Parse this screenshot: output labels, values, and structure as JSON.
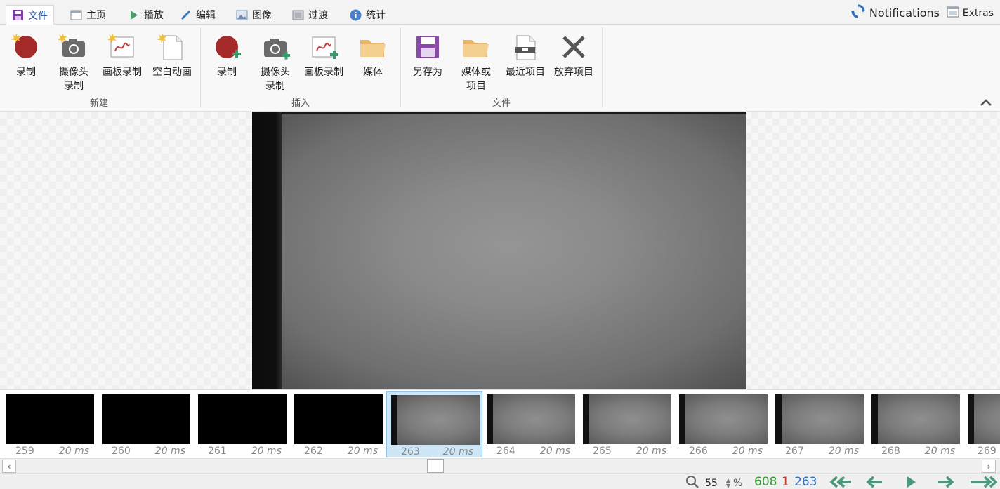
{
  "tabs": [
    {
      "label": "文件",
      "icon": "save-icon"
    },
    {
      "label": "主页",
      "icon": "window-icon"
    },
    {
      "label": "播放",
      "icon": "play-icon"
    },
    {
      "label": "编辑",
      "icon": "pencil-icon"
    },
    {
      "label": "图像",
      "icon": "image-icon"
    },
    {
      "label": "过渡",
      "icon": "transition-icon"
    },
    {
      "label": "统计",
      "icon": "info-icon"
    }
  ],
  "header": {
    "notifications": "Notifications",
    "extras": "Extras"
  },
  "ribbon": {
    "new_group": {
      "label": "新建",
      "buttons": [
        {
          "label": "录制"
        },
        {
          "label": "摄像头\n录制"
        },
        {
          "label": "画板录制"
        },
        {
          "label": "空白动画"
        }
      ]
    },
    "insert_group": {
      "label": "插入",
      "buttons": [
        {
          "label": "录制"
        },
        {
          "label": "摄像头\n录制"
        },
        {
          "label": "画板录制"
        },
        {
          "label": "媒体"
        }
      ]
    },
    "file_group": {
      "label": "文件",
      "buttons": [
        {
          "label": "另存为"
        },
        {
          "label": "媒体或\n项目"
        },
        {
          "label": "最近项目"
        },
        {
          "label": "放弃项目"
        }
      ]
    }
  },
  "frames": [
    {
      "num": "259",
      "dur": "20 ms"
    },
    {
      "num": "260",
      "dur": "20 ms"
    },
    {
      "num": "261",
      "dur": "20 ms"
    },
    {
      "num": "262",
      "dur": "20 ms"
    },
    {
      "num": "263",
      "dur": "20 ms"
    },
    {
      "num": "264",
      "dur": "20 ms"
    },
    {
      "num": "265",
      "dur": "20 ms"
    },
    {
      "num": "266",
      "dur": "20 ms"
    },
    {
      "num": "267",
      "dur": "20 ms"
    },
    {
      "num": "268",
      "dur": "20 ms"
    },
    {
      "num": "269",
      "dur": ""
    }
  ],
  "status": {
    "zoom_value": "55",
    "zoom_unit": "%",
    "total_frames": "608",
    "selected_count": "1",
    "current_frame": "263",
    "colors": {
      "total": "#2e9a2e",
      "selected": "#c0392b",
      "current": "#2a6fbf"
    }
  }
}
